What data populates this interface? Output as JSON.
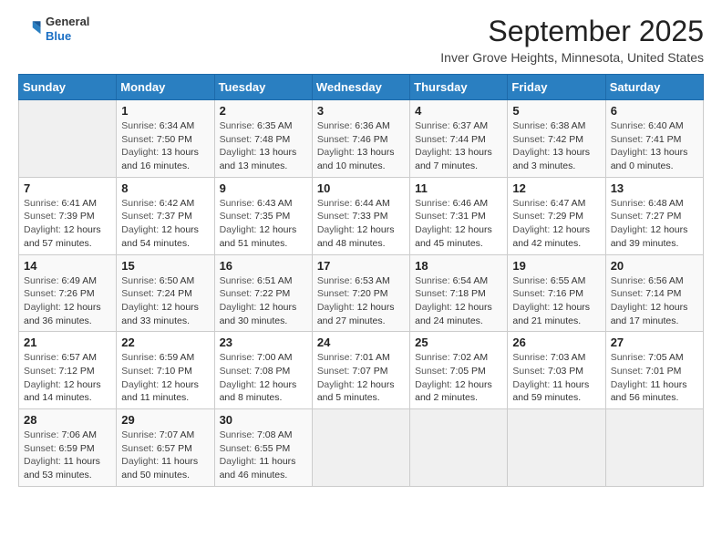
{
  "logo": {
    "line1": "General",
    "line2": "Blue"
  },
  "title": "September 2025",
  "subtitle": "Inver Grove Heights, Minnesota, United States",
  "days_of_week": [
    "Sunday",
    "Monday",
    "Tuesday",
    "Wednesday",
    "Thursday",
    "Friday",
    "Saturday"
  ],
  "weeks": [
    [
      {
        "day": "",
        "sunrise": "",
        "sunset": "",
        "daylight": ""
      },
      {
        "day": "1",
        "sunrise": "6:34 AM",
        "sunset": "7:50 PM",
        "daylight": "13 hours and 16 minutes."
      },
      {
        "day": "2",
        "sunrise": "6:35 AM",
        "sunset": "7:48 PM",
        "daylight": "13 hours and 13 minutes."
      },
      {
        "day": "3",
        "sunrise": "6:36 AM",
        "sunset": "7:46 PM",
        "daylight": "13 hours and 10 minutes."
      },
      {
        "day": "4",
        "sunrise": "6:37 AM",
        "sunset": "7:44 PM",
        "daylight": "13 hours and 7 minutes."
      },
      {
        "day": "5",
        "sunrise": "6:38 AM",
        "sunset": "7:42 PM",
        "daylight": "13 hours and 3 minutes."
      },
      {
        "day": "6",
        "sunrise": "6:40 AM",
        "sunset": "7:41 PM",
        "daylight": "13 hours and 0 minutes."
      }
    ],
    [
      {
        "day": "7",
        "sunrise": "6:41 AM",
        "sunset": "7:39 PM",
        "daylight": "12 hours and 57 minutes."
      },
      {
        "day": "8",
        "sunrise": "6:42 AM",
        "sunset": "7:37 PM",
        "daylight": "12 hours and 54 minutes."
      },
      {
        "day": "9",
        "sunrise": "6:43 AM",
        "sunset": "7:35 PM",
        "daylight": "12 hours and 51 minutes."
      },
      {
        "day": "10",
        "sunrise": "6:44 AM",
        "sunset": "7:33 PM",
        "daylight": "12 hours and 48 minutes."
      },
      {
        "day": "11",
        "sunrise": "6:46 AM",
        "sunset": "7:31 PM",
        "daylight": "12 hours and 45 minutes."
      },
      {
        "day": "12",
        "sunrise": "6:47 AM",
        "sunset": "7:29 PM",
        "daylight": "12 hours and 42 minutes."
      },
      {
        "day": "13",
        "sunrise": "6:48 AM",
        "sunset": "7:27 PM",
        "daylight": "12 hours and 39 minutes."
      }
    ],
    [
      {
        "day": "14",
        "sunrise": "6:49 AM",
        "sunset": "7:26 PM",
        "daylight": "12 hours and 36 minutes."
      },
      {
        "day": "15",
        "sunrise": "6:50 AM",
        "sunset": "7:24 PM",
        "daylight": "12 hours and 33 minutes."
      },
      {
        "day": "16",
        "sunrise": "6:51 AM",
        "sunset": "7:22 PM",
        "daylight": "12 hours and 30 minutes."
      },
      {
        "day": "17",
        "sunrise": "6:53 AM",
        "sunset": "7:20 PM",
        "daylight": "12 hours and 27 minutes."
      },
      {
        "day": "18",
        "sunrise": "6:54 AM",
        "sunset": "7:18 PM",
        "daylight": "12 hours and 24 minutes."
      },
      {
        "day": "19",
        "sunrise": "6:55 AM",
        "sunset": "7:16 PM",
        "daylight": "12 hours and 21 minutes."
      },
      {
        "day": "20",
        "sunrise": "6:56 AM",
        "sunset": "7:14 PM",
        "daylight": "12 hours and 17 minutes."
      }
    ],
    [
      {
        "day": "21",
        "sunrise": "6:57 AM",
        "sunset": "7:12 PM",
        "daylight": "12 hours and 14 minutes."
      },
      {
        "day": "22",
        "sunrise": "6:59 AM",
        "sunset": "7:10 PM",
        "daylight": "12 hours and 11 minutes."
      },
      {
        "day": "23",
        "sunrise": "7:00 AM",
        "sunset": "7:08 PM",
        "daylight": "12 hours and 8 minutes."
      },
      {
        "day": "24",
        "sunrise": "7:01 AM",
        "sunset": "7:07 PM",
        "daylight": "12 hours and 5 minutes."
      },
      {
        "day": "25",
        "sunrise": "7:02 AM",
        "sunset": "7:05 PM",
        "daylight": "12 hours and 2 minutes."
      },
      {
        "day": "26",
        "sunrise": "7:03 AM",
        "sunset": "7:03 PM",
        "daylight": "11 hours and 59 minutes."
      },
      {
        "day": "27",
        "sunrise": "7:05 AM",
        "sunset": "7:01 PM",
        "daylight": "11 hours and 56 minutes."
      }
    ],
    [
      {
        "day": "28",
        "sunrise": "7:06 AM",
        "sunset": "6:59 PM",
        "daylight": "11 hours and 53 minutes."
      },
      {
        "day": "29",
        "sunrise": "7:07 AM",
        "sunset": "6:57 PM",
        "daylight": "11 hours and 50 minutes."
      },
      {
        "day": "30",
        "sunrise": "7:08 AM",
        "sunset": "6:55 PM",
        "daylight": "11 hours and 46 minutes."
      },
      {
        "day": "",
        "sunrise": "",
        "sunset": "",
        "daylight": ""
      },
      {
        "day": "",
        "sunrise": "",
        "sunset": "",
        "daylight": ""
      },
      {
        "day": "",
        "sunrise": "",
        "sunset": "",
        "daylight": ""
      },
      {
        "day": "",
        "sunrise": "",
        "sunset": "",
        "daylight": ""
      }
    ]
  ],
  "labels": {
    "sunrise": "Sunrise:",
    "sunset": "Sunset:",
    "daylight": "Daylight:"
  }
}
